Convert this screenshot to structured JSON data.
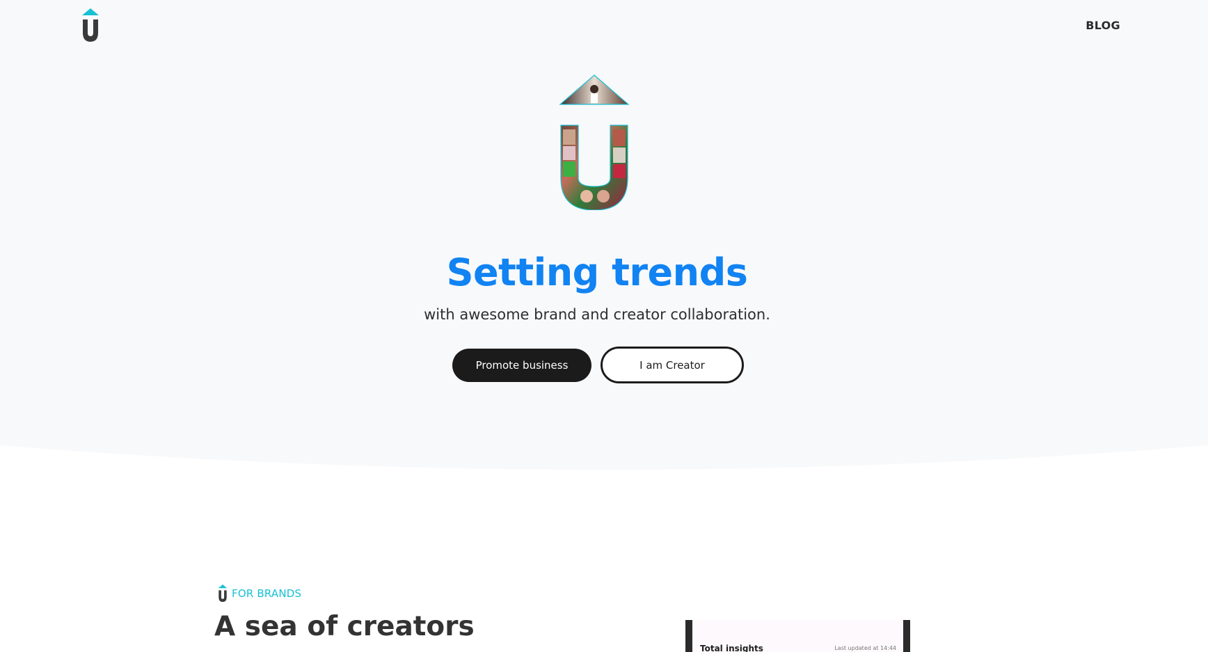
{
  "nav": {
    "blog_label": "BLOG"
  },
  "hero": {
    "title": "Setting trends",
    "subtitle": "with awesome brand and creator collaboration.",
    "primary_button": "Promote business",
    "secondary_button": "I am Creator"
  },
  "brands_section": {
    "tag": "FOR BRANDS",
    "title": "A sea of creators"
  },
  "phone_preview": {
    "title": "Total insights",
    "updated": "Last updated at 14:44"
  },
  "colors": {
    "brand_blue": "#1183f2",
    "accent_teal": "#17c0d4",
    "dark": "#1b1b1b",
    "hero_bg": "#f8f9fb"
  },
  "icons": {
    "logo": "brand-u-arrow-logo",
    "emblem": "creator-collage-u-emblem"
  }
}
